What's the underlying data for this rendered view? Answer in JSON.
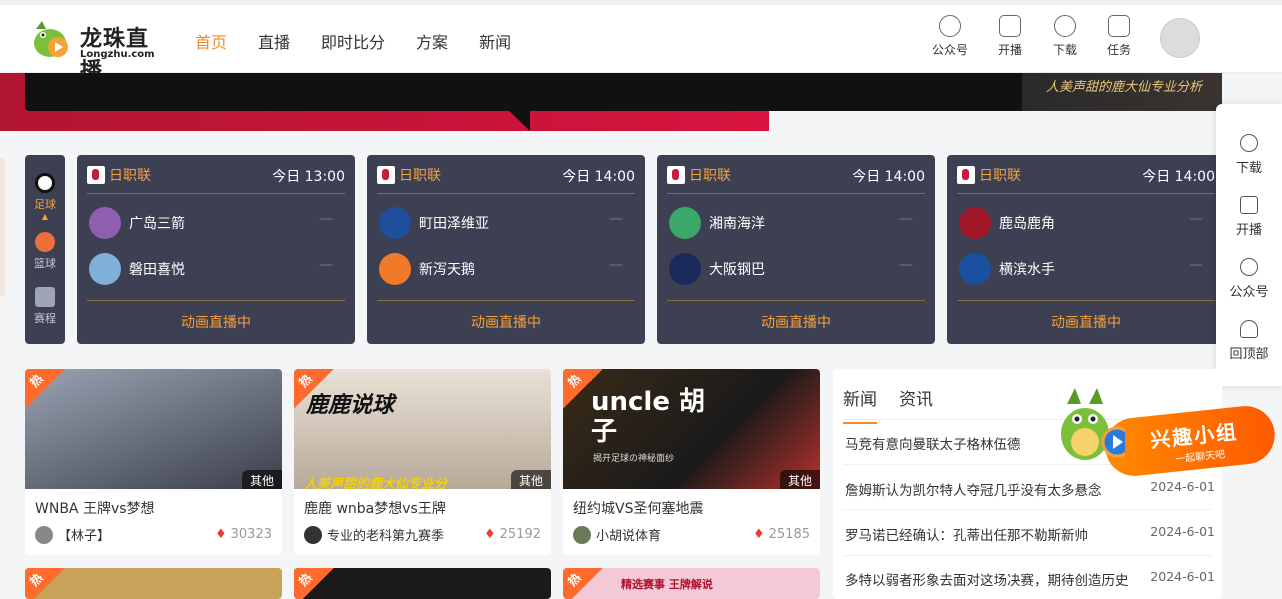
{
  "header": {
    "logo_title": "龙珠直播",
    "logo_sub": "Longzhu.com",
    "nav": [
      {
        "label": "首页",
        "active": true
      },
      {
        "label": "直播",
        "active": false
      },
      {
        "label": "即时比分",
        "active": false
      },
      {
        "label": "方案",
        "active": false
      },
      {
        "label": "新闻",
        "active": false
      }
    ],
    "actions": [
      {
        "label": "公众号",
        "icon": "wechat-icon"
      },
      {
        "label": "开播",
        "icon": "broadcast-icon"
      },
      {
        "label": "下载",
        "icon": "download-cloud-icon"
      },
      {
        "label": "任务",
        "icon": "task-icon"
      }
    ]
  },
  "banner": {
    "slogan": "人美声甜的鹿大仙专业分析"
  },
  "sport_tabs": [
    {
      "label": "足球",
      "active": true,
      "icon": "soccer-ball-icon"
    },
    {
      "label": "篮球",
      "active": false,
      "icon": "basketball-icon"
    },
    {
      "label": "赛程",
      "active": false,
      "icon": "calendar-icon"
    }
  ],
  "matches": [
    {
      "league": "日职联",
      "time": "今日 13:00",
      "home": "广岛三箭",
      "away": "磐田喜悦",
      "home_score": "—",
      "away_score": "—",
      "status": "动画直播中"
    },
    {
      "league": "日职联",
      "time": "今日 14:00",
      "home": "町田泽维亚",
      "away": "新泻天鹅",
      "home_score": "—",
      "away_score": "—",
      "status": "动画直播中"
    },
    {
      "league": "日职联",
      "time": "今日 14:00",
      "home": "湘南海洋",
      "away": "大阪钢巴",
      "home_score": "—",
      "away_score": "—",
      "status": "动画直播中"
    },
    {
      "league": "日职联",
      "time": "今日 14:00",
      "home": "鹿岛鹿角",
      "away": "横滨水手",
      "home_score": "—",
      "away_score": "—",
      "status": "动画直播中"
    }
  ],
  "float_panel": [
    {
      "label": "下载",
      "icon": "download-icon"
    },
    {
      "label": "开播",
      "icon": "camera-icon"
    },
    {
      "label": "公众号",
      "icon": "wechat-icon"
    },
    {
      "label": "回顶部",
      "icon": "rocket-icon"
    }
  ],
  "videos": [
    {
      "hot": "热",
      "tag": "其他",
      "title": "WNBA 王牌vs梦想",
      "author": "【林子】",
      "views": "30323",
      "thumb_color": "#6b7280"
    },
    {
      "hot": "热",
      "tag": "其他",
      "title": "鹿鹿 wnba梦想vs王牌",
      "author": "专业的老科第九赛季",
      "views": "25192",
      "thumb_color": "#d8cfc4",
      "thumb_text": "鹿鹿说球",
      "thumb_caption": "人美声甜的鹿大仙专业分"
    },
    {
      "hot": "热",
      "tag": "其他",
      "title": "纽约城VS圣何塞地震",
      "author": "小胡说体育",
      "views": "25185",
      "thumb_color": "#2a2a2a",
      "thumb_text": "uncle 胡子",
      "thumb_caption": "揭开足球の神秘面纱"
    }
  ],
  "videos_row2": [
    {
      "hot": "热",
      "thumb_color": "#c9a25a"
    },
    {
      "hot": "热",
      "thumb_color": "#1a1a1a"
    },
    {
      "hot": "热",
      "thumb_color": "#f3c9d6",
      "thumb_text": "精选赛事 王牌解说"
    }
  ],
  "news": {
    "tabs": [
      {
        "label": "新闻",
        "active": true
      },
      {
        "label": "资讯",
        "active": false
      }
    ],
    "items": [
      {
        "title": "马竞有意向曼联太子格林伍德",
        "date": ""
      },
      {
        "title": "詹姆斯认为凯尔特人夺冠几乎没有太多悬念",
        "date": "2024-6-01"
      },
      {
        "title": "罗马诺已经确认：孔蒂出任那不勒斯新帅",
        "date": "2024-6-01"
      },
      {
        "title": "多特以弱者形象去面对这场决赛，期待创造历史",
        "date": "2024-6-01"
      }
    ]
  },
  "badge": {
    "title": "兴趣小组",
    "sub": "一起聊天吧"
  }
}
